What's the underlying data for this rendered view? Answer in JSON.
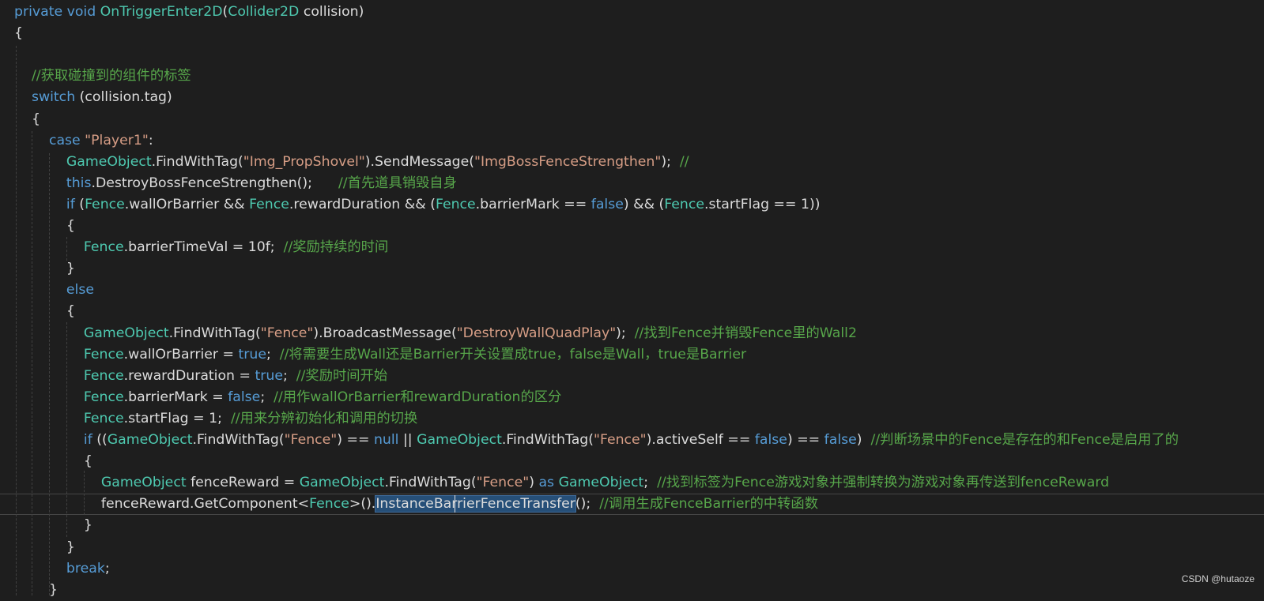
{
  "colors": {
    "background": "#1e1e1e",
    "keyword": "#569cd6",
    "type": "#4ec9b0",
    "string": "#d69d85",
    "comment": "#57a64a",
    "text": "#dcdcdc",
    "selection": "#264f78"
  },
  "lines": [
    [
      [
        "kw",
        "private void "
      ],
      [
        "typ",
        "OnTriggerEnter2D"
      ],
      [
        "txt",
        "("
      ],
      [
        "typ",
        "Collider2D"
      ],
      [
        "txt",
        " collision)"
      ]
    ],
    [
      [
        "txt",
        "{"
      ]
    ],
    [],
    [
      [
        "cmt",
        "    //获取碰撞到的组件的标签"
      ]
    ],
    [
      [
        "kw",
        "    switch"
      ],
      [
        "txt",
        " (collision.tag)"
      ]
    ],
    [
      [
        "txt",
        "    {"
      ]
    ],
    [
      [
        "kw",
        "        case "
      ],
      [
        "str",
        "\"Player1\""
      ],
      [
        "txt",
        ":"
      ]
    ],
    [
      [
        "typ",
        "            GameObject"
      ],
      [
        "txt",
        ".FindWithTag("
      ],
      [
        "str",
        "\"Img_PropShovel\""
      ],
      [
        "txt",
        ").SendMessage("
      ],
      [
        "str",
        "\"ImgBossFenceStrengthen\""
      ],
      [
        "txt",
        ");  "
      ],
      [
        "cmt",
        "//"
      ]
    ],
    [
      [
        "kw",
        "            this"
      ],
      [
        "txt",
        ".DestroyBossFenceStrengthen();      "
      ],
      [
        "cmt",
        "//首先道具销毁自身"
      ]
    ],
    [
      [
        "kw",
        "            if"
      ],
      [
        "txt",
        " ("
      ],
      [
        "typ",
        "Fence"
      ],
      [
        "txt",
        ".wallOrBarrier && "
      ],
      [
        "typ",
        "Fence"
      ],
      [
        "txt",
        ".rewardDuration && ("
      ],
      [
        "typ",
        "Fence"
      ],
      [
        "txt",
        ".barrierMark == "
      ],
      [
        "kw",
        "false"
      ],
      [
        "txt",
        ") && ("
      ],
      [
        "typ",
        "Fence"
      ],
      [
        "txt",
        ".startFlag == 1))"
      ]
    ],
    [
      [
        "txt",
        "            {"
      ]
    ],
    [
      [
        "typ",
        "                Fence"
      ],
      [
        "txt",
        ".barrierTimeVal = 10f;  "
      ],
      [
        "cmt",
        "//奖励持续的时间"
      ]
    ],
    [
      [
        "txt",
        "            }"
      ]
    ],
    [
      [
        "kw",
        "            else"
      ]
    ],
    [
      [
        "txt",
        "            {"
      ]
    ],
    [
      [
        "typ",
        "                GameObject"
      ],
      [
        "txt",
        ".FindWithTag("
      ],
      [
        "str",
        "\"Fence\""
      ],
      [
        "txt",
        ").BroadcastMessage("
      ],
      [
        "str",
        "\"DestroyWallQuadPlay\""
      ],
      [
        "txt",
        ");  "
      ],
      [
        "cmt",
        "//找到Fence并销毁Fence里的Wall2"
      ]
    ],
    [
      [
        "typ",
        "                Fence"
      ],
      [
        "txt",
        ".wallOrBarrier = "
      ],
      [
        "kw",
        "true"
      ],
      [
        "txt",
        ";  "
      ],
      [
        "cmt",
        "//将需要生成Wall还是Barrier开关设置成true，false是Wall，true是Barrier"
      ]
    ],
    [
      [
        "typ",
        "                Fence"
      ],
      [
        "txt",
        ".rewardDuration = "
      ],
      [
        "kw",
        "true"
      ],
      [
        "txt",
        ";  "
      ],
      [
        "cmt",
        "//奖励时间开始"
      ]
    ],
    [
      [
        "typ",
        "                Fence"
      ],
      [
        "txt",
        ".barrierMark = "
      ],
      [
        "kw",
        "false"
      ],
      [
        "txt",
        ";  "
      ],
      [
        "cmt",
        "//用作wallOrBarrier和rewardDuration的区分"
      ]
    ],
    [
      [
        "typ",
        "                Fence"
      ],
      [
        "txt",
        ".startFlag = 1;  "
      ],
      [
        "cmt",
        "//用来分辨初始化和调用的切换"
      ]
    ],
    [
      [
        "kw",
        "                if"
      ],
      [
        "txt",
        " (("
      ],
      [
        "typ",
        "GameObject"
      ],
      [
        "txt",
        ".FindWithTag("
      ],
      [
        "str",
        "\"Fence\""
      ],
      [
        "txt",
        ") == "
      ],
      [
        "kw",
        "null"
      ],
      [
        "txt",
        " || "
      ],
      [
        "typ",
        "GameObject"
      ],
      [
        "txt",
        ".FindWithTag("
      ],
      [
        "str",
        "\"Fence\""
      ],
      [
        "txt",
        ").activeSelf == "
      ],
      [
        "kw",
        "false"
      ],
      [
        "txt",
        ") == "
      ],
      [
        "kw",
        "false"
      ],
      [
        "txt",
        ")  "
      ],
      [
        "cmt",
        "//判断场景中的Fence是存在的和Fence是启用了的"
      ]
    ],
    [
      [
        "txt",
        "                {"
      ]
    ],
    [
      [
        "typ",
        "                    GameObject"
      ],
      [
        "txt",
        " fenceReward = "
      ],
      [
        "typ",
        "GameObject"
      ],
      [
        "txt",
        ".FindWithTag("
      ],
      [
        "str",
        "\"Fence\""
      ],
      [
        "txt",
        ") "
      ],
      [
        "kw",
        "as"
      ],
      [
        "txt",
        " "
      ],
      [
        "typ",
        "GameObject"
      ],
      [
        "txt",
        ";  "
      ],
      [
        "cmt",
        "//找到标签为Fence游戏对象并强制转换为游戏对象再传送到fenceReward"
      ]
    ],
    [
      [
        "txt",
        "                    fenceReward.GetComponent<"
      ],
      [
        "typ",
        "Fence"
      ],
      [
        "txt",
        ">()."
      ],
      [
        "hl",
        "InstanceBarrierFenceTransfer"
      ],
      [
        "txt",
        "();  "
      ],
      [
        "cmt",
        "//调用生成FenceBarrier的中转函数"
      ]
    ],
    [
      [
        "txt",
        "                }"
      ]
    ],
    [
      [
        "txt",
        "            }"
      ]
    ],
    [
      [
        "kw",
        "            break"
      ],
      [
        "txt",
        ";"
      ]
    ],
    [
      [
        "txt",
        "        }"
      ]
    ]
  ],
  "watermark": "CSDN @hutaoze"
}
